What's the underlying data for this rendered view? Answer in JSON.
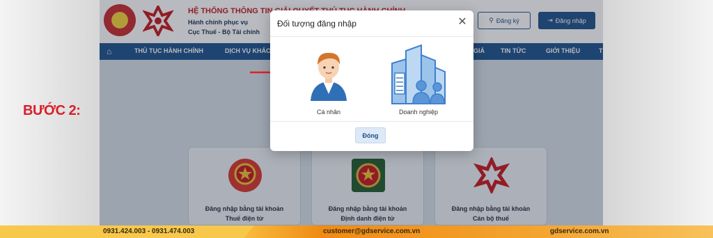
{
  "step_label": "BƯỚC 2:",
  "site": {
    "title": "HỆ THỐNG THÔNG TIN GIẢI QUYẾT THỦ TỤC HÀNH CHÍNH",
    "subtitle_line1": "Hành chính phục vụ",
    "subtitle_line2": "Cục Thuế - Bộ Tài chính",
    "register_label": "Đăng ký",
    "login_label": "Đăng nhập"
  },
  "nav": {
    "items": [
      "THỦ TỤC HÀNH CHÍNH",
      "DỊCH VỤ KHÁC",
      "GIÁ",
      "TIN TỨC",
      "GIỚI THIỆU",
      "T"
    ]
  },
  "cards": [
    {
      "line1": "Đăng nhập bằng tài khoản",
      "line2": "Thuế điện tử"
    },
    {
      "line1": "Đăng nhập bằng tài khoản",
      "line2": "Định danh điện tử"
    },
    {
      "line1": "Đăng nhập bằng tài khoản",
      "line2": "Cán bộ thuế"
    }
  ],
  "modal": {
    "title": "Đối tượng đăng nhập",
    "option_person": "Cá nhân",
    "option_business": "Doanh nghiệp",
    "close_button": "Đóng"
  },
  "footer": {
    "phones": "0931.424.003 - 0931.474.003",
    "email": "customer@gdservice.com.vn",
    "website": "gdservice.com.vn"
  },
  "colors": {
    "brand_red": "#c4161c",
    "nav_blue": "#1a4f8b",
    "step_red": "#d81f2a",
    "footer_orange": "#ef8b14"
  }
}
